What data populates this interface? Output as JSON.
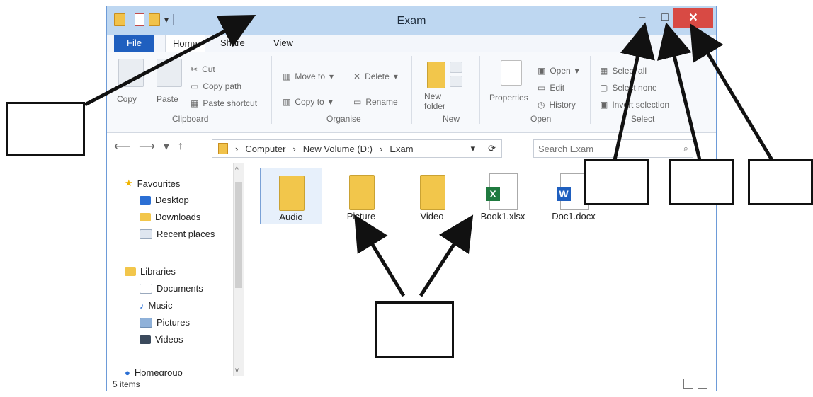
{
  "window": {
    "title": "Exam",
    "controls": {
      "minimize": "–",
      "maximize": "□",
      "close": "✕"
    }
  },
  "ribbon_tabs": {
    "file": "File",
    "home": "Home",
    "share": "Share",
    "view": "View"
  },
  "ribbon": {
    "clipboard": {
      "copy": "Copy",
      "paste": "Paste",
      "cut": "Cut",
      "copy_path": "Copy path",
      "paste_shortcut": "Paste shortcut",
      "group": "Clipboard"
    },
    "organise": {
      "move_to": "Move to",
      "copy_to": "Copy to",
      "delete": "Delete",
      "rename": "Rename",
      "group": "Organise"
    },
    "new": {
      "new_folder_line1": "New",
      "new_folder_line2": "folder",
      "group": "New"
    },
    "open": {
      "properties": "Properties",
      "open": "Open",
      "edit": "Edit",
      "history": "History",
      "group": "Open"
    },
    "select": {
      "select_all": "Select all",
      "select_none": "Select none",
      "invert_selection": "Invert selection",
      "group": "Select"
    }
  },
  "address": {
    "breadcrumbs": [
      "Computer",
      "New Volume (D:)",
      "Exam"
    ],
    "search_placeholder": "Search Exam"
  },
  "sidebar": {
    "favourites": "Favourites",
    "items": [
      "Desktop",
      "Downloads",
      "Recent places"
    ],
    "libraries": "Libraries",
    "lib_items": [
      "Documents",
      "Music",
      "Pictures",
      "Videos"
    ],
    "homegroup": "Homegroup"
  },
  "files": [
    {
      "name": "Audio",
      "type": "folder"
    },
    {
      "name": "Picture",
      "type": "folder"
    },
    {
      "name": "Video",
      "type": "folder"
    },
    {
      "name": "Book1.xlsx",
      "type": "excel"
    },
    {
      "name": "Doc1.docx",
      "type": "word"
    }
  ],
  "status": {
    "items": "5 items"
  },
  "colors": {
    "accent": "#1f5fbf",
    "close_red": "#d84a44",
    "folder": "#f2c64b"
  }
}
